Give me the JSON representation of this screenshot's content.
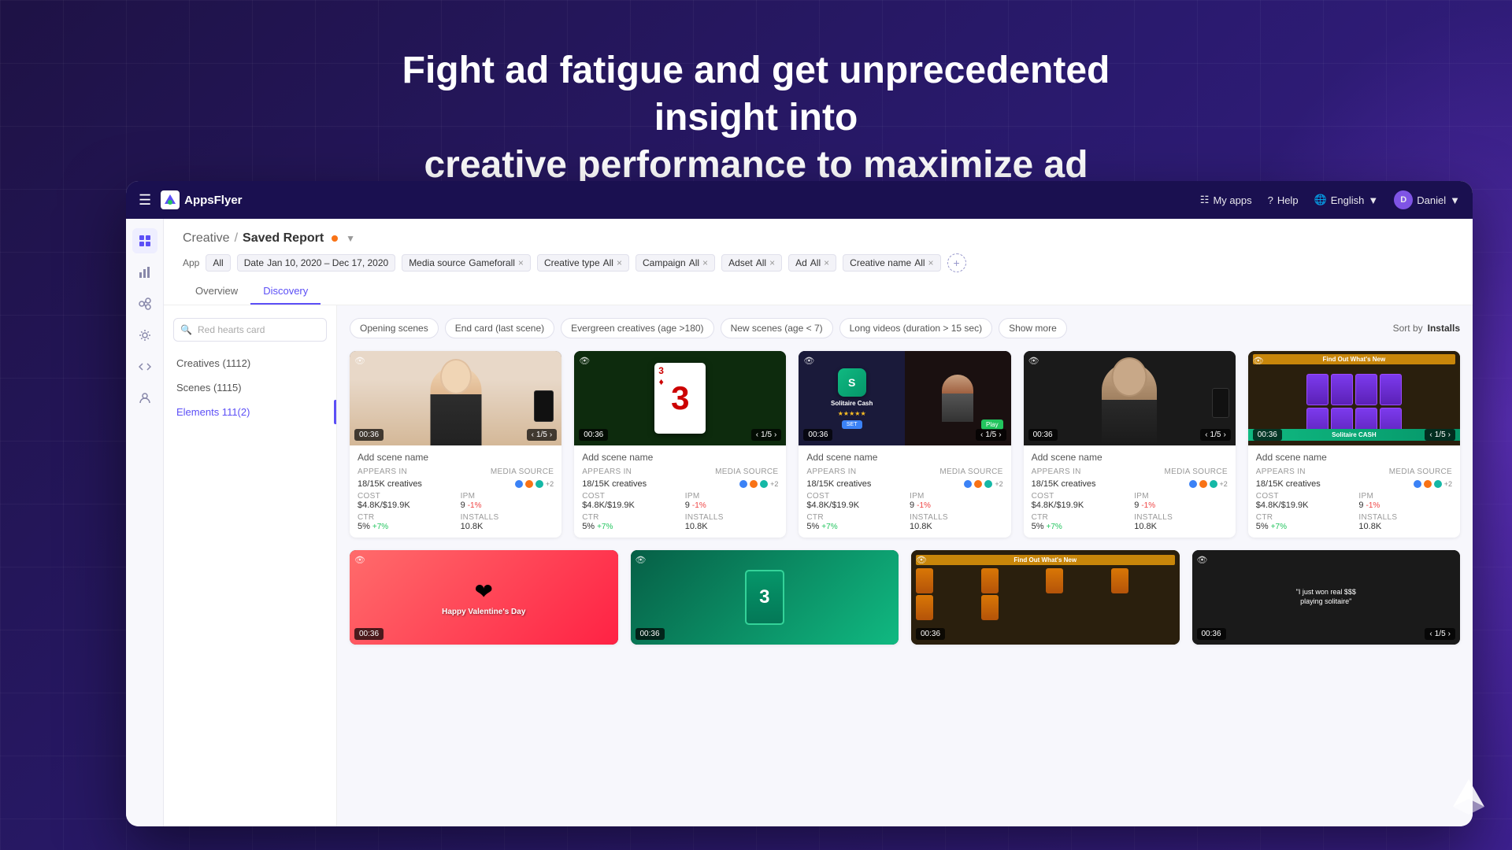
{
  "background": {
    "headline_line1": "Fight ad fatigue and get unprecedented insight into",
    "headline_line2": "creative performance to maximize ad spend"
  },
  "nav": {
    "logo_text": "AppsFlyer",
    "my_apps": "My apps",
    "help": "Help",
    "language": "English",
    "user_name": "Daniel"
  },
  "page": {
    "breadcrumb_parent": "Creative",
    "breadcrumb_separator": "/",
    "breadcrumb_current": "Saved Report"
  },
  "filters": {
    "app_label": "App",
    "app_value": "All",
    "date_label": "Date",
    "date_value": "Jan 10, 2020 – Dec 17, 2020",
    "media_source_label": "Media source",
    "media_source_value": "Gameforall",
    "creative_type_label": "Creative type",
    "creative_type_value": "All",
    "campaign_label": "Campaign",
    "campaign_value": "All",
    "adset_label": "Adset",
    "adset_value": "All",
    "ad_label": "Ad",
    "ad_value": "All",
    "creative_name_label": "Creative name",
    "creative_name_value": "All"
  },
  "tabs": {
    "overview": "Overview",
    "discovery": "Discovery"
  },
  "search_placeholder": "Red hearts card",
  "left_nav": {
    "items": [
      {
        "label": "Creatives (1112)",
        "id": "creatives"
      },
      {
        "label": "Scenes (1115)",
        "id": "scenes"
      },
      {
        "label": "Elements 111(2)",
        "id": "elements",
        "active": true
      }
    ]
  },
  "scene_filters": [
    "Opening scenes",
    "End card (last scene)",
    "Evergreen creatives (age >180)",
    "New scenes (age < 7)",
    "Long videos (duration > 15 sec)",
    "Show more"
  ],
  "sort": {
    "label": "Sort by",
    "value": "Installs"
  },
  "cards": [
    {
      "title": "Add scene name",
      "time": "00:36",
      "nav": "1/5",
      "appears_in": "18/15K creatives",
      "cost": "$4.8K/$19.9K",
      "ipm": "9",
      "ipm_delta": "-1%",
      "ctr": "5%",
      "ctr_delta": "+7%",
      "installs": "10.8K",
      "thumb_type": "lady"
    },
    {
      "title": "Add scene name",
      "time": "00:36",
      "nav": "1/5",
      "appears_in": "18/15K creatives",
      "cost": "$4.8K/$19.9K",
      "ipm": "9",
      "ipm_delta": "-1%",
      "ctr": "5%",
      "ctr_delta": "+7%",
      "installs": "10.8K",
      "thumb_type": "cards"
    },
    {
      "title": "Add scene name",
      "time": "00:36",
      "nav": "1/5",
      "appears_in": "18/15K creatives",
      "cost": "$4.8K/$19.9K",
      "ipm": "9",
      "ipm_delta": "-1%",
      "ctr": "5%",
      "ctr_delta": "+7%",
      "installs": "10.8K",
      "thumb_type": "solitaire"
    },
    {
      "title": "Add scene name",
      "time": "00:36",
      "nav": "1/5",
      "appears_in": "18/15K creatives",
      "cost": "$4.8K/$19.9K",
      "ipm": "9",
      "ipm_delta": "-1%",
      "ctr": "5%",
      "ctr_delta": "+7%",
      "installs": "10.8K",
      "thumb_type": "guy"
    },
    {
      "title": "Add scene name",
      "time": "00:36",
      "nav": "1/5",
      "appears_in": "18/15K creatives",
      "cost": "$4.8K/$19.9K",
      "ipm": "9",
      "ipm_delta": "-1%",
      "ctr": "5%",
      "ctr_delta": "+7%",
      "installs": "10.8K",
      "thumb_type": "tiles"
    }
  ],
  "second_row_cards": [
    {
      "thumb_type": "valentines",
      "title": "Happy Valentine's Day"
    },
    {
      "thumb_type": "green_game",
      "title": ""
    },
    {
      "thumb_type": "find_out",
      "title": ""
    },
    {
      "thumb_type": "quote",
      "title": "\"I just won real $$$ playing solitaire\""
    }
  ],
  "labels": {
    "appears_in": "APPEARS IN",
    "media_source": "MEDIA SOURCE",
    "cost": "COST",
    "ipm": "IPM",
    "ctr": "CTR",
    "installs": "INSTALLS"
  }
}
